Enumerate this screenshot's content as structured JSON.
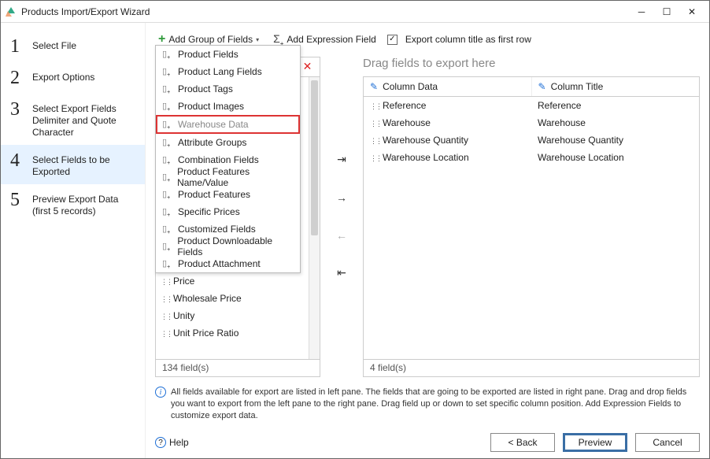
{
  "window": {
    "title": "Products Import/Export Wizard"
  },
  "steps": [
    {
      "num": "1",
      "label": "Select File"
    },
    {
      "num": "2",
      "label": "Export Options"
    },
    {
      "num": "3",
      "label": "Select Export Fields Delimiter and Quote Character"
    },
    {
      "num": "4",
      "label": "Select Fields to be Exported"
    },
    {
      "num": "5",
      "label": "Preview Export Data (first 5 records)"
    }
  ],
  "toolbar": {
    "add_group": "Add Group of Fields",
    "add_expr": "Add Expression Field",
    "first_row": "Export column title as first row"
  },
  "dropdown": {
    "items": [
      "Product Fields",
      "Product Lang Fields",
      "Product Tags",
      "Product Images",
      "Warehouse Data",
      "Attribute Groups",
      "Combination Fields",
      "Product Features Name/Value",
      "Product Features",
      "Specific Prices",
      "Customized Fields",
      "Product Downloadable Fields",
      "Product Attachment"
    ],
    "highlight_index": 4
  },
  "left_panel": {
    "visible_fields": [
      "Price",
      "Wholesale Price",
      "Unity",
      "Unit Price Ratio"
    ],
    "footer": "134 field(s)"
  },
  "right_panel": {
    "placeholder": "Drag fields to export here",
    "col_data": "Column Data",
    "col_title": "Column Title",
    "rows": [
      {
        "data": "Reference",
        "title": "Reference"
      },
      {
        "data": "Warehouse",
        "title": "Warehouse"
      },
      {
        "data": "Warehouse Quantity",
        "title": "Warehouse Quantity"
      },
      {
        "data": "Warehouse Location",
        "title": "Warehouse Location"
      }
    ],
    "footer": "4 field(s)"
  },
  "info": "All fields available for export are listed in left pane. The fields that are going to be exported are listed in right pane. Drag and drop fields you want to export from the left pane to the right pane. Drag field up or down to set specific column position. Add Expression Fields to customize export data.",
  "buttons": {
    "help": "Help",
    "back": "< Back",
    "preview": "Preview",
    "cancel": "Cancel"
  }
}
